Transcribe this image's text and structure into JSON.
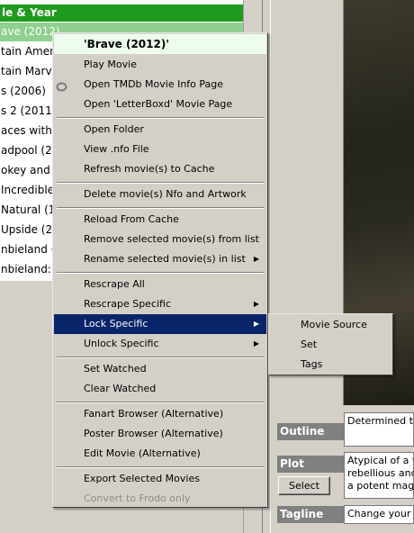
{
  "list": {
    "header": "le & Year",
    "rows": [
      "ave (2012)",
      "tain Ameri",
      "tain Marve",
      "s (2006)",
      "s 2 (2011)",
      "aces with W",
      "adpool (201",
      "okey and th",
      " Incredible",
      " Natural (1",
      " Upside (2",
      "nbieland (2",
      "nbieland: D"
    ],
    "selected_index": 0
  },
  "menu": {
    "title": "'Brave (2012)'",
    "play_movie": "Play Movie",
    "open_tmdb": "Open TMDb Movie Info Page",
    "open_letterboxd": "Open 'LetterBoxd' Movie Page",
    "open_folder": "Open Folder",
    "view_nfo": "View .nfo File",
    "refresh_cache": "Refresh movie(s) to Cache",
    "delete_nfo": "Delete movie(s) Nfo and Artwork",
    "reload_cache": "Reload From Cache",
    "remove_selected": "Remove selected movie(s) from list",
    "rename_selected": "Rename selected movie(s) in list",
    "rescrape_all": "Rescrape All",
    "rescrape_specific": "Rescrape Specific",
    "lock_specific": "Lock Specific",
    "unlock_specific": "Unlock Specific",
    "set_watched": "Set Watched",
    "clear_watched": "Clear Watched",
    "fanart_browser": "Fanart Browser (Alternative)",
    "poster_browser": "Poster Browser (Alternative)",
    "edit_movie": "Edit Movie (Alternative)",
    "export_selected": "Export Selected Movies",
    "convert_frodo": "Convert to Frodo only"
  },
  "submenu": {
    "movie_source": "Movie Source",
    "set": "Set",
    "tags": "Tags"
  },
  "details": {
    "outline_label": "Outline",
    "outline_text": "Determined to",
    "plot_label": "Plot",
    "plot_lines": [
      "Atypical of a tr",
      "rebellious and",
      "a potent magi"
    ],
    "select_button": "Select",
    "tagline_label": "Tagline",
    "tagline_text": "Change your f"
  },
  "colors": {
    "header_green": "#1f9a1f",
    "selected_row": "#8fcf8f",
    "menu_highlight": "#0a246a",
    "label_gray": "#808080"
  },
  "icons": {
    "tmdb": "tmdb-icon",
    "submenu_arrow": "triangle-right-icon"
  }
}
